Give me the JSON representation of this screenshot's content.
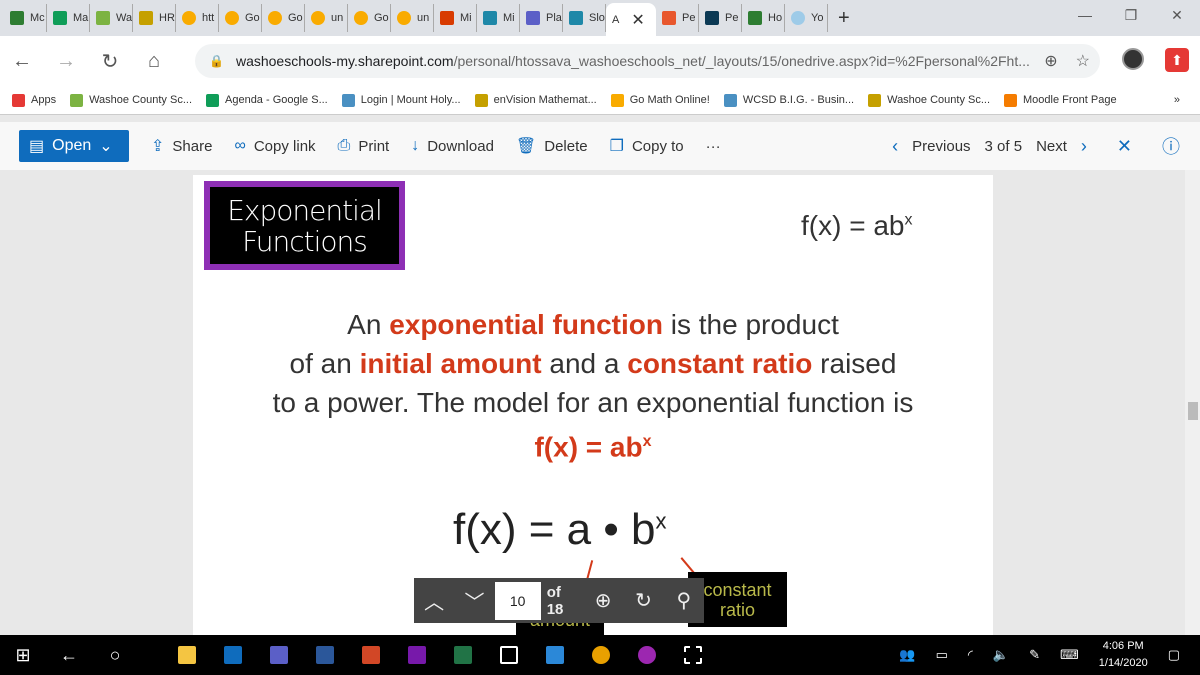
{
  "tabs": [
    {
      "label": "Mc",
      "color": "#2e7d32"
    },
    {
      "label": "Ma",
      "color": "#0f9d58"
    },
    {
      "label": "Wa",
      "color": "#7cb342"
    },
    {
      "label": "HR",
      "color": "#c5a000"
    },
    {
      "label": "htt",
      "color": "#f9ab00",
      "circle": true
    },
    {
      "label": "Go",
      "color": "#f9ab00",
      "circle": true
    },
    {
      "label": "Go",
      "color": "#f9ab00",
      "circle": true
    },
    {
      "label": "un",
      "color": "#f9ab00",
      "circle": true
    },
    {
      "label": "Go",
      "color": "#f9ab00",
      "circle": true
    },
    {
      "label": "un",
      "color": "#f9ab00",
      "circle": true
    },
    {
      "label": "Mi",
      "color": "#d83b01"
    },
    {
      "label": "Mi",
      "color": "#1e88a8"
    },
    {
      "label": "Pla",
      "color": "#5b5fc7"
    },
    {
      "label": "Slo",
      "color": "#1e88a8"
    },
    {
      "label": "A",
      "active": true
    },
    {
      "label": "Pe",
      "color": "#e8572d"
    },
    {
      "label": "Pe",
      "color": "#0b3954"
    },
    {
      "label": "Ho",
      "color": "#2e7d32"
    },
    {
      "label": "Yo",
      "color": "#9ecbe8",
      "circle": true
    }
  ],
  "window": {
    "minimize": "—",
    "restore": "❐",
    "close": "✕",
    "new_tab": "+",
    "tab_close": "✕"
  },
  "address": {
    "host": "washoeschools-my.sharepoint.com",
    "path": "/personal/htossava_washoeschools_net/_layouts/15/onedrive.aspx?id=%2Fpersonal%2Fht..."
  },
  "bookmarks": [
    {
      "label": "Apps",
      "color": "#e53935"
    },
    {
      "label": "Washoe County Sc...",
      "color": "#7cb342"
    },
    {
      "label": "Agenda - Google S...",
      "color": "#0f9d58"
    },
    {
      "label": "Login | Mount Holy...",
      "color": "#4a90c2"
    },
    {
      "label": "enVision Mathemat...",
      "color": "#c5a000"
    },
    {
      "label": "Go Math Online!",
      "color": "#f9ab00"
    },
    {
      "label": "WCSD B.I.G. - Busin...",
      "color": "#4a90c2"
    },
    {
      "label": "Washoe County Sc...",
      "color": "#c5a000"
    },
    {
      "label": "Moodle Front Page",
      "color": "#f57c00"
    }
  ],
  "bookmarks_more": "»",
  "toolbar": {
    "open": "Open",
    "share": "Share",
    "copy_link": "Copy link",
    "print": "Print",
    "download": "Download",
    "delete": "Delete",
    "copy_to": "Copy to",
    "more": "···",
    "previous": "Previous",
    "position": "3 of 5",
    "next": "Next"
  },
  "slide": {
    "title_line1": "Exponential",
    "title_line2": "Functions",
    "corner_formula": "f(x) = ab",
    "sup": "x",
    "p1a": "An ",
    "p1b": "exponential function",
    "p1c": " is the product",
    "p2a": "of an ",
    "p2b": "initial amount",
    "p2c": " and a ",
    "p2d": "constant ratio",
    "p2e": " raised",
    "p3": "to a power. The model for an exponential function is",
    "p4": "f(x) = ab",
    "formula": "f(x) = a • b",
    "label_a": "amount",
    "label_b1": "constant",
    "label_b2": "ratio"
  },
  "pdf_controls": {
    "page": "10",
    "of": "of 18"
  },
  "taskbar": {
    "time": "4:06 PM",
    "date": "1/14/2020"
  },
  "colors": {
    "accent": "#0f6cbd",
    "highlight": "#d33a1a",
    "title_border": "#8e2fb5"
  }
}
